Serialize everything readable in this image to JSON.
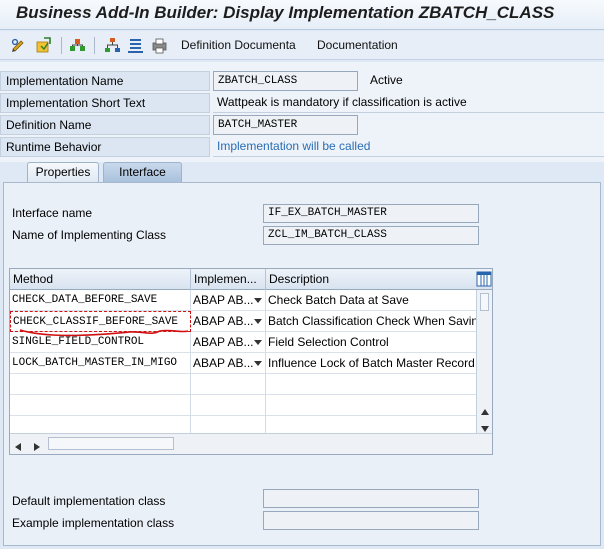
{
  "window": {
    "title": "Business Add-In Builder: Display Implementation ZBATCH_CLASS"
  },
  "toolbar": {
    "icons": [
      "change-display-icon",
      "activate-icon",
      "hierarchy-icon",
      "tree-icon",
      "list-icon",
      "print-icon"
    ],
    "definition_doc_label": "Definition Documenta",
    "documentation_label": "Documentation"
  },
  "header": {
    "impl_name_label": "Implementation Name",
    "impl_name_value": "ZBATCH_CLASS",
    "impl_status": "Active",
    "impl_short_text_label": "Implementation Short Text",
    "impl_short_text_value": "Wattpeak is mandatory if classification is active",
    "definition_name_label": "Definition Name",
    "definition_name_value": "BATCH_MASTER",
    "runtime_behavior_label": "Runtime Behavior",
    "runtime_behavior_value": "Implementation will be called"
  },
  "tabs": [
    {
      "label": "Properties",
      "active": false
    },
    {
      "label": "Interface",
      "active": true
    }
  ],
  "interface": {
    "interface_name_label": "Interface name",
    "interface_name_value": "IF_EX_BATCH_MASTER",
    "impl_class_label": "Name of Implementing Class",
    "impl_class_value": "ZCL_IM_BATCH_CLASS",
    "default_impl_class_label": "Default implementation class",
    "default_impl_class_value": "",
    "example_impl_class_label": "Example implementation class",
    "example_impl_class_value": ""
  },
  "grid": {
    "columns": [
      "Method",
      "Implemen...",
      "Description"
    ],
    "rows": [
      {
        "method": "CHECK_DATA_BEFORE_SAVE",
        "impl": "ABAP AB...",
        "description": "Check Batch Data at Save"
      },
      {
        "method": "CHECK_CLASSIF_BEFORE_SAVE",
        "impl": "ABAP AB...",
        "description": "Batch Classification Check When Saving"
      },
      {
        "method": "SINGLE_FIELD_CONTROL",
        "impl": "ABAP AB...",
        "description": "Field Selection Control"
      },
      {
        "method": "LOCK_BATCH_MASTER_IN_MIGO",
        "impl": "ABAP AB...",
        "description": "Influence Lock of Batch Master Record"
      }
    ],
    "highlighted_row": 1,
    "annotation_color": "#d01010"
  },
  "colors": {
    "link_blue": "#2a6db3",
    "selected_tab": "#a9c1dc"
  }
}
